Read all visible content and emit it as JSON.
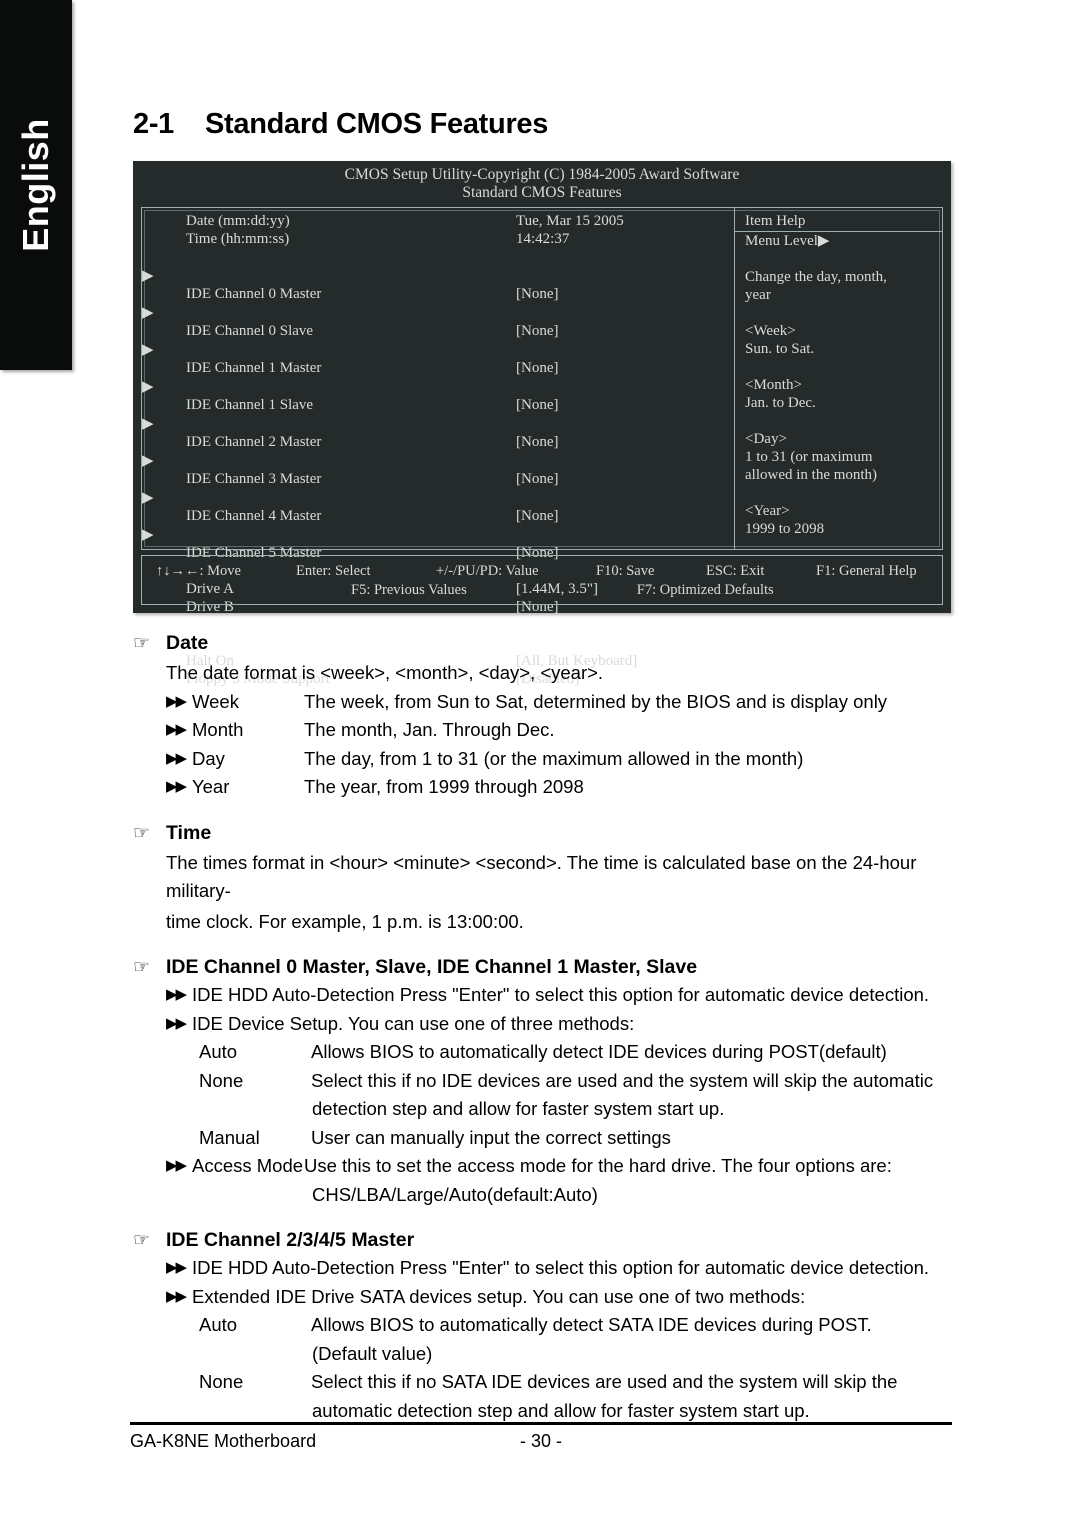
{
  "sidebar": {
    "language_tab": "English"
  },
  "heading": {
    "number": "2-1",
    "title": "Standard CMOS Features"
  },
  "bios": {
    "title_line1": "CMOS Setup Utility-Copyright (C) 1984-2005 Award Software",
    "title_line2": "Standard CMOS Features",
    "rows": [
      {
        "label": "Date (mm:dd:yy)",
        "value": "Tue, Mar  15  2005",
        "arrow": ""
      },
      {
        "label": "Time (hh:mm:ss)",
        "value": "14:42:37",
        "arrow": ""
      },
      {
        "label": "IDE Channel 0 Master",
        "value": "[None]",
        "arrow": "▶"
      },
      {
        "label": "IDE Channel 0 Slave",
        "value": "[None]",
        "arrow": "▶"
      },
      {
        "label": "IDE Channel 1 Master",
        "value": "[None]",
        "arrow": "▶"
      },
      {
        "label": "IDE Channel 1 Slave",
        "value": "[None]",
        "arrow": "▶"
      },
      {
        "label": "IDE Channel 2 Master",
        "value": "[None]",
        "arrow": "▶"
      },
      {
        "label": "IDE Channel 3 Master",
        "value": "[None]",
        "arrow": "▶"
      },
      {
        "label": "IDE Channel 4 Master",
        "value": "[None]",
        "arrow": "▶"
      },
      {
        "label": "IDE Channel 5 Master",
        "value": "[None]",
        "arrow": "▶"
      },
      {
        "label": "Drive A",
        "value": "[1.44M, 3.5\"]",
        "arrow": ""
      },
      {
        "label": "Drive B",
        "value": "[None]",
        "arrow": ""
      },
      {
        "label": "Halt On",
        "value": "[All, But Keyboard]",
        "arrow": ""
      },
      {
        "label": "Floppy 3 Mode Support",
        "value": "[Disabled]",
        "arrow": ""
      }
    ],
    "help": {
      "title": "Item Help",
      "menu_level": "Menu Level",
      "menu_level_arrow": "▶",
      "lines": [
        "Change the day, month,",
        "year",
        "",
        "<Week>",
        "Sun. to Sat.",
        "",
        "<Month>",
        "Jan. to Dec.",
        "",
        "<Day>",
        "1 to 31 (or maximum",
        "allowed in the month)",
        "",
        "<Year>",
        "1999 to 2098"
      ]
    },
    "keys": {
      "move": "↑↓→←: Move",
      "enter": "Enter: Select",
      "value": "+/-/PU/PD: Value",
      "save": "F10: Save",
      "esc": "ESC: Exit",
      "general_help": "F1: General Help",
      "previous": "F5: Previous Values",
      "optimized": "F7: Optimized Defaults"
    }
  },
  "sections": [
    {
      "hand": "☞",
      "title": "Date",
      "intro": "The date format is <week>, <month>, <day>, <year>.",
      "defs": [
        {
          "bullet": "▶▶",
          "term": "Week",
          "desc": "The week, from Sun to Sat, determined by the BIOS and is display only"
        },
        {
          "bullet": "▶▶",
          "term": "Month",
          "desc": "The month, Jan. Through Dec."
        },
        {
          "bullet": "▶▶",
          "term": "Day",
          "desc": "The day, from 1 to 31 (or the maximum allowed in the month)"
        },
        {
          "bullet": "▶▶",
          "term": "Year",
          "desc": "The year, from 1999 through 2098"
        }
      ]
    },
    {
      "hand": "☞",
      "title": "Time",
      "para_line1": "The times format in <hour> <minute> <second>. The time is calculated base on the 24-hour military-",
      "para_line2": "time clock. For example, 1 p.m. is 13:00:00."
    },
    {
      "hand": "☞",
      "title": "IDE Channel 0 Master, Slave, IDE Channel 1 Master, Slave",
      "bullet_lines": [
        {
          "bullet": "▶▶",
          "text": "IDE HDD Auto-Detection  Press \"Enter\" to select this option for automatic device detection."
        },
        {
          "bullet": "▶▶",
          "text": "IDE Device Setup.  You can use one of three methods:"
        }
      ],
      "defs": [
        {
          "term": "Auto",
          "desc": "Allows BIOS to automatically detect IDE devices during POST(default)",
          "cont": ""
        },
        {
          "term": "None",
          "desc": "Select this if no IDE devices are used and the system will skip the automatic",
          "cont": "detection step and allow for faster system start up."
        },
        {
          "term": "Manual",
          "desc": "User can manually input the correct settings",
          "cont": ""
        }
      ],
      "access_mode": {
        "bullet": "▶▶",
        "term": "Access Mode",
        "desc": "Use this to set the access mode for the hard drive. The four options are:",
        "cont": "CHS/LBA/Large/Auto(default:Auto)"
      }
    },
    {
      "hand": "☞",
      "title": "IDE Channel 2/3/4/5 Master",
      "bullet_lines": [
        {
          "bullet": "▶▶",
          "text": "IDE HDD Auto-Detection  Press \"Enter\" to select this option for automatic device detection."
        },
        {
          "bullet": "▶▶",
          "text": "Extended IDE Drive SATA devices setup. You can use one of two methods:"
        }
      ],
      "defs": [
        {
          "term": "Auto",
          "desc": "Allows BIOS to automatically detect SATA IDE devices during POST.",
          "cont": "(Default value)"
        },
        {
          "term": "None",
          "desc": "Select this if no SATA IDE devices are used and the system will skip the",
          "cont": "automatic detection step and allow for faster system start up."
        }
      ]
    }
  ],
  "footer": {
    "product": "GA-K8NE Motherboard",
    "page": "- 30 -"
  }
}
